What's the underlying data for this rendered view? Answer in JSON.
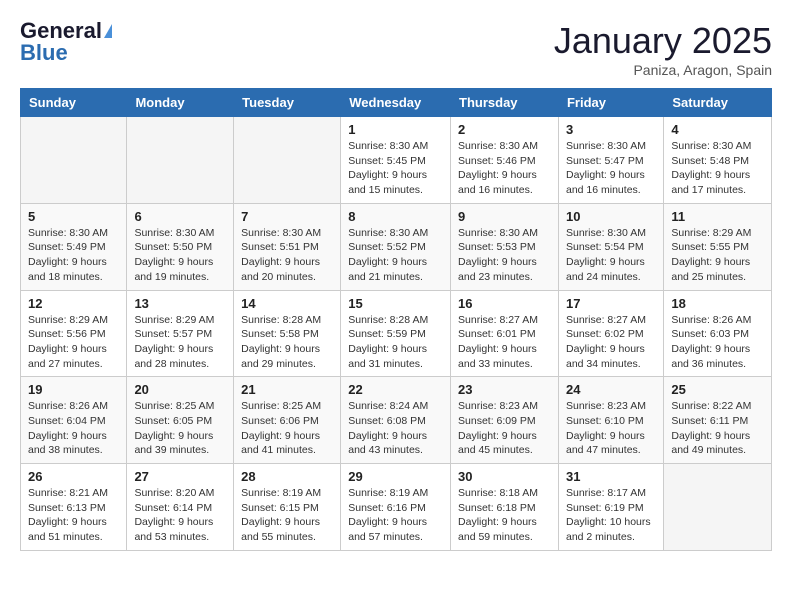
{
  "logo": {
    "general": "General",
    "blue": "Blue"
  },
  "header": {
    "month": "January 2025",
    "location": "Paniza, Aragon, Spain"
  },
  "weekdays": [
    "Sunday",
    "Monday",
    "Tuesday",
    "Wednesday",
    "Thursday",
    "Friday",
    "Saturday"
  ],
  "weeks": [
    [
      {
        "day": "",
        "info": ""
      },
      {
        "day": "",
        "info": ""
      },
      {
        "day": "",
        "info": ""
      },
      {
        "day": "1",
        "info": "Sunrise: 8:30 AM\nSunset: 5:45 PM\nDaylight: 9 hours\nand 15 minutes."
      },
      {
        "day": "2",
        "info": "Sunrise: 8:30 AM\nSunset: 5:46 PM\nDaylight: 9 hours\nand 16 minutes."
      },
      {
        "day": "3",
        "info": "Sunrise: 8:30 AM\nSunset: 5:47 PM\nDaylight: 9 hours\nand 16 minutes."
      },
      {
        "day": "4",
        "info": "Sunrise: 8:30 AM\nSunset: 5:48 PM\nDaylight: 9 hours\nand 17 minutes."
      }
    ],
    [
      {
        "day": "5",
        "info": "Sunrise: 8:30 AM\nSunset: 5:49 PM\nDaylight: 9 hours\nand 18 minutes."
      },
      {
        "day": "6",
        "info": "Sunrise: 8:30 AM\nSunset: 5:50 PM\nDaylight: 9 hours\nand 19 minutes."
      },
      {
        "day": "7",
        "info": "Sunrise: 8:30 AM\nSunset: 5:51 PM\nDaylight: 9 hours\nand 20 minutes."
      },
      {
        "day": "8",
        "info": "Sunrise: 8:30 AM\nSunset: 5:52 PM\nDaylight: 9 hours\nand 21 minutes."
      },
      {
        "day": "9",
        "info": "Sunrise: 8:30 AM\nSunset: 5:53 PM\nDaylight: 9 hours\nand 23 minutes."
      },
      {
        "day": "10",
        "info": "Sunrise: 8:30 AM\nSunset: 5:54 PM\nDaylight: 9 hours\nand 24 minutes."
      },
      {
        "day": "11",
        "info": "Sunrise: 8:29 AM\nSunset: 5:55 PM\nDaylight: 9 hours\nand 25 minutes."
      }
    ],
    [
      {
        "day": "12",
        "info": "Sunrise: 8:29 AM\nSunset: 5:56 PM\nDaylight: 9 hours\nand 27 minutes."
      },
      {
        "day": "13",
        "info": "Sunrise: 8:29 AM\nSunset: 5:57 PM\nDaylight: 9 hours\nand 28 minutes."
      },
      {
        "day": "14",
        "info": "Sunrise: 8:28 AM\nSunset: 5:58 PM\nDaylight: 9 hours\nand 29 minutes."
      },
      {
        "day": "15",
        "info": "Sunrise: 8:28 AM\nSunset: 5:59 PM\nDaylight: 9 hours\nand 31 minutes."
      },
      {
        "day": "16",
        "info": "Sunrise: 8:27 AM\nSunset: 6:01 PM\nDaylight: 9 hours\nand 33 minutes."
      },
      {
        "day": "17",
        "info": "Sunrise: 8:27 AM\nSunset: 6:02 PM\nDaylight: 9 hours\nand 34 minutes."
      },
      {
        "day": "18",
        "info": "Sunrise: 8:26 AM\nSunset: 6:03 PM\nDaylight: 9 hours\nand 36 minutes."
      }
    ],
    [
      {
        "day": "19",
        "info": "Sunrise: 8:26 AM\nSunset: 6:04 PM\nDaylight: 9 hours\nand 38 minutes."
      },
      {
        "day": "20",
        "info": "Sunrise: 8:25 AM\nSunset: 6:05 PM\nDaylight: 9 hours\nand 39 minutes."
      },
      {
        "day": "21",
        "info": "Sunrise: 8:25 AM\nSunset: 6:06 PM\nDaylight: 9 hours\nand 41 minutes."
      },
      {
        "day": "22",
        "info": "Sunrise: 8:24 AM\nSunset: 6:08 PM\nDaylight: 9 hours\nand 43 minutes."
      },
      {
        "day": "23",
        "info": "Sunrise: 8:23 AM\nSunset: 6:09 PM\nDaylight: 9 hours\nand 45 minutes."
      },
      {
        "day": "24",
        "info": "Sunrise: 8:23 AM\nSunset: 6:10 PM\nDaylight: 9 hours\nand 47 minutes."
      },
      {
        "day": "25",
        "info": "Sunrise: 8:22 AM\nSunset: 6:11 PM\nDaylight: 9 hours\nand 49 minutes."
      }
    ],
    [
      {
        "day": "26",
        "info": "Sunrise: 8:21 AM\nSunset: 6:13 PM\nDaylight: 9 hours\nand 51 minutes."
      },
      {
        "day": "27",
        "info": "Sunrise: 8:20 AM\nSunset: 6:14 PM\nDaylight: 9 hours\nand 53 minutes."
      },
      {
        "day": "28",
        "info": "Sunrise: 8:19 AM\nSunset: 6:15 PM\nDaylight: 9 hours\nand 55 minutes."
      },
      {
        "day": "29",
        "info": "Sunrise: 8:19 AM\nSunset: 6:16 PM\nDaylight: 9 hours\nand 57 minutes."
      },
      {
        "day": "30",
        "info": "Sunrise: 8:18 AM\nSunset: 6:18 PM\nDaylight: 9 hours\nand 59 minutes."
      },
      {
        "day": "31",
        "info": "Sunrise: 8:17 AM\nSunset: 6:19 PM\nDaylight: 10 hours\nand 2 minutes."
      },
      {
        "day": "",
        "info": ""
      }
    ]
  ]
}
